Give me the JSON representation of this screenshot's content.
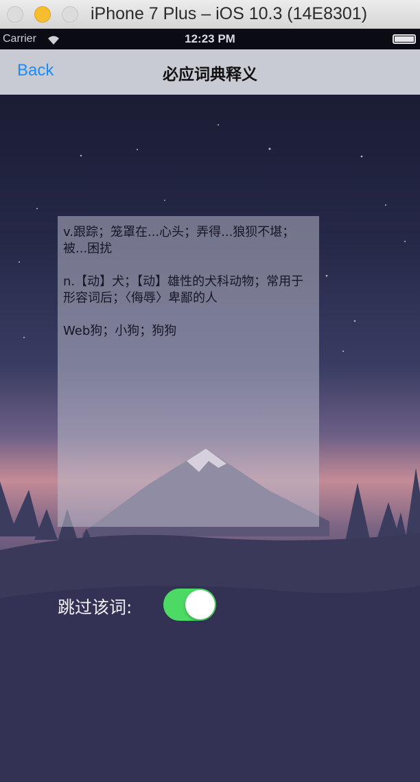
{
  "window": {
    "title": "iPhone 7 Plus – iOS 10.3 (14E8301)"
  },
  "status_bar": {
    "carrier": "Carrier",
    "time": "12:23 PM"
  },
  "nav_bar": {
    "back_label": "Back",
    "title": "必应词典释义"
  },
  "definitions": [
    "v.跟踪；笼罩在...心头；弄得...狼狈不堪；被...困扰",
    "n.【动】犬；【动】雄性的犬科动物；常用于形容词后；〈侮辱〉卑鄙的人",
    "Web狗；小狗；狗狗"
  ],
  "skip_word": {
    "label": "跳过该词:",
    "enabled": true
  },
  "colors": {
    "accent": "#1c8bf6",
    "toggle_on": "#4cd964"
  }
}
